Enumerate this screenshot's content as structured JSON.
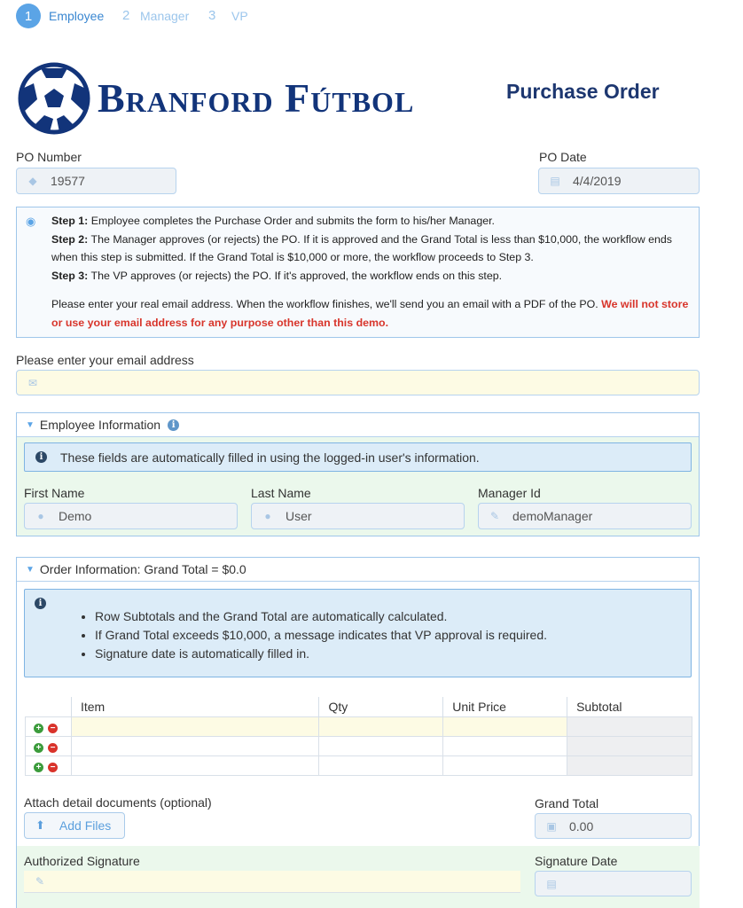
{
  "steps": [
    {
      "num": "1",
      "label": "Employee"
    },
    {
      "num": "2",
      "label": "Manager"
    },
    {
      "num": "3",
      "label": "VP"
    }
  ],
  "header": {
    "brand": "Branford Fútbol",
    "title": "Purchase Order"
  },
  "po": {
    "number_label": "PO Number",
    "number_value": "19577",
    "date_label": "PO Date",
    "date_value": "4/4/2019"
  },
  "instructions": {
    "step1_head": "Step 1:",
    "step1_text": " Employee completes the Purchase Order and submits the form to his/her Manager.",
    "step2_head": "Step 2:",
    "step2_text": " The Manager approves (or rejects) the PO. If it is approved and the Grand Total is less than $10,000, the workflow ends when this step is submitted. If the Grand Total is $10,000 or more, the workflow proceeds to Step 3.",
    "step3_head": "Step 3:",
    "step3_text": " The VP approves (or rejects) the PO. If it's approved, the workflow ends on this step.",
    "email_note": "Please enter your real email address. When the workflow finishes, we'll send you an email with a PDF of the PO. ",
    "email_warning": "We will not store or use your email address for any purpose other than this demo."
  },
  "email": {
    "label": "Please enter your email address",
    "value": ""
  },
  "employee": {
    "title": "Employee Information",
    "note": "These fields are automatically filled in using the logged-in user's information.",
    "first_name_label": "First Name",
    "first_name_value": "Demo",
    "last_name_label": "Last Name",
    "last_name_value": "User",
    "manager_label": "Manager Id",
    "manager_value": "demoManager"
  },
  "order": {
    "title": "Order Information: Grand Total = $0.0",
    "notes": [
      "Row Subtotals and the Grand Total are automatically calculated.",
      "If Grand Total exceeds $10,000, a message indicates that VP approval is required.",
      "Signature date is automatically filled in."
    ],
    "columns": [
      "Item",
      "Qty",
      "Unit Price",
      "Subtotal"
    ],
    "rows": [
      {
        "item": "",
        "qty": "",
        "unit_price": "",
        "subtotal": ""
      },
      {
        "item": "",
        "qty": "",
        "unit_price": "",
        "subtotal": ""
      },
      {
        "item": "",
        "qty": "",
        "unit_price": "",
        "subtotal": ""
      }
    ],
    "attach_label": "Attach detail documents (optional)",
    "add_files_label": "Add Files",
    "grand_total_label": "Grand Total",
    "grand_total_value": "0.00",
    "signature_label": "Authorized Signature",
    "signature_value": "",
    "signature_date_label": "Signature Date",
    "signature_date_value": ""
  },
  "colors": {
    "accent": "#5ba4e6",
    "brand": "#12347a",
    "warning": "#d8352b"
  }
}
